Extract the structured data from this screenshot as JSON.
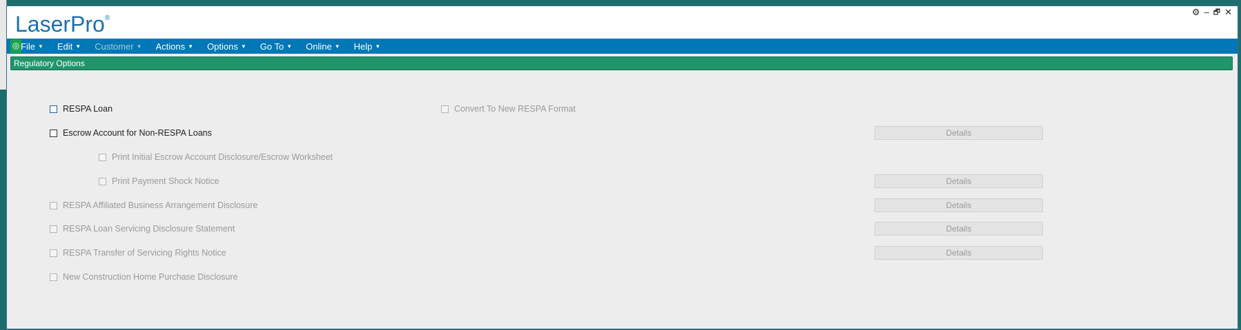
{
  "app": {
    "logo": "LaserPro",
    "logo_mark": "®"
  },
  "window_controls": {
    "settings_icon": "⚙",
    "minimize_icon": "–",
    "restore_icon": "🗗",
    "close_icon": "✕"
  },
  "menu": [
    {
      "label": "File",
      "enabled": true
    },
    {
      "label": "Edit",
      "enabled": true
    },
    {
      "label": "Customer",
      "enabled": false
    },
    {
      "label": "Actions",
      "enabled": true
    },
    {
      "label": "Options",
      "enabled": true
    },
    {
      "label": "Go To",
      "enabled": true
    },
    {
      "label": "Online",
      "enabled": true
    },
    {
      "label": "Help",
      "enabled": true
    }
  ],
  "menu_caret": "▼",
  "section_title": "Regulatory Options",
  "options": {
    "respa_loan": {
      "label": "RESPA Loan",
      "checked": false
    },
    "convert_format": {
      "label": "Convert To New RESPA Format",
      "checked": false
    },
    "escrow_nonrespa": {
      "label": "Escrow Account for Non-RESPA Loans",
      "checked": false
    },
    "print_initial_escrow": {
      "label": "Print Initial Escrow Account Disclosure/Escrow Worksheet",
      "checked": false
    },
    "print_payment_shock": {
      "label": "Print Payment Shock Notice",
      "checked": false
    },
    "affiliated_business": {
      "label": "RESPA Affiliated Business Arrangement Disclosure",
      "checked": false
    },
    "loan_servicing": {
      "label": "RESPA Loan Servicing Disclosure Statement",
      "checked": false
    },
    "transfer_servicing": {
      "label": "RESPA Transfer of Servicing Rights Notice",
      "checked": false
    },
    "new_construction": {
      "label": "New Construction Home Purchase Disclosure",
      "checked": false
    }
  },
  "details_label": "Details",
  "colors": {
    "menubar": "#0077b6",
    "section_bar": "#22946c",
    "logo": "#1d6fa8"
  }
}
